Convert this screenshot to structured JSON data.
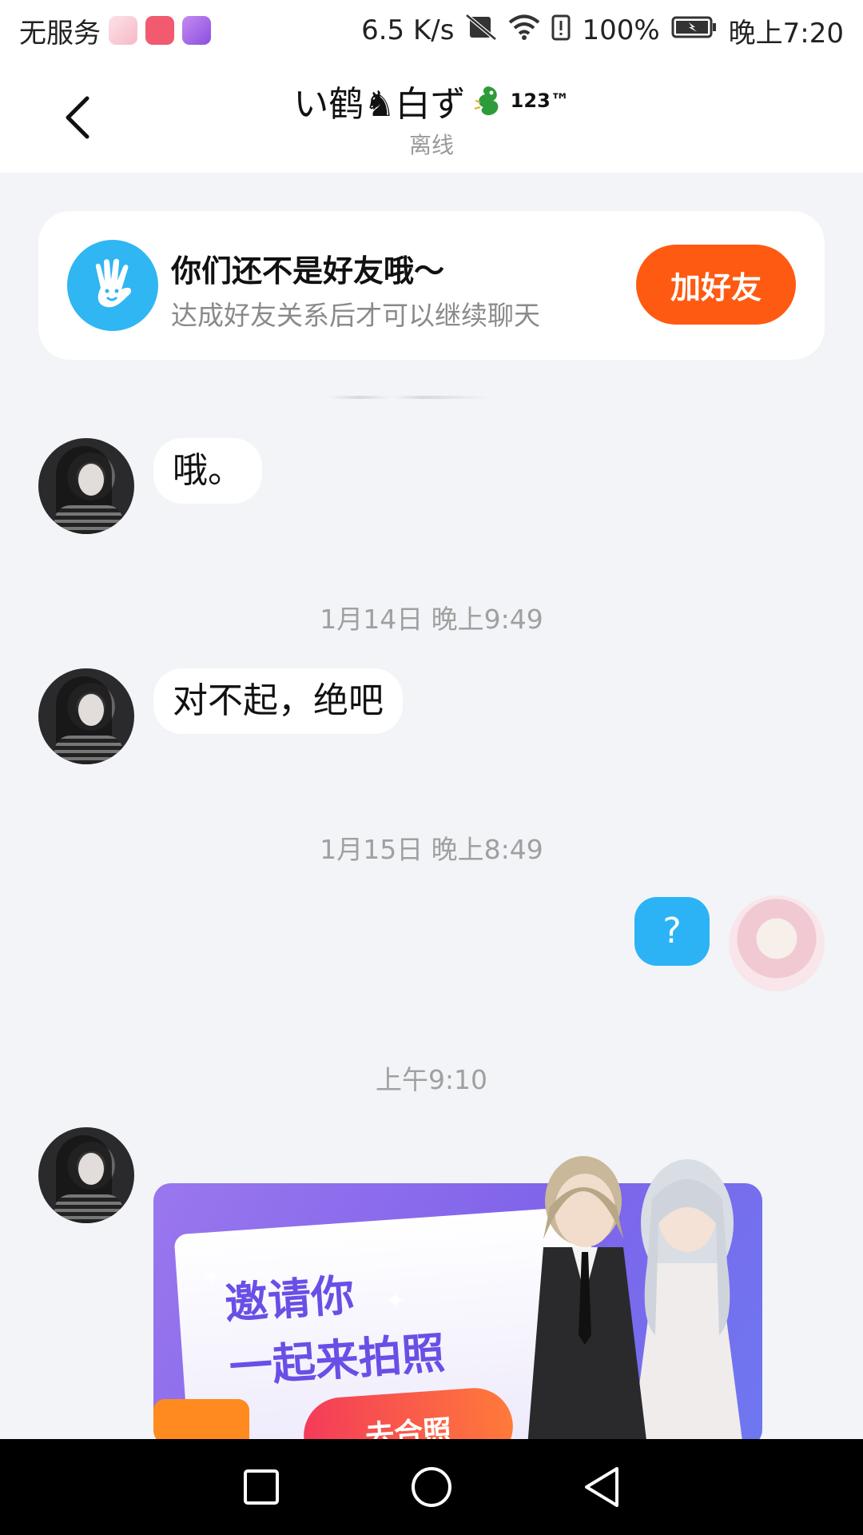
{
  "status_bar": {
    "carrier": "无服务",
    "speed": "6.5 K/s",
    "battery": "100%",
    "time": "晚上7:20",
    "icons": [
      "notification-app-icon",
      "huawei-store-icon",
      "theme-app-icon",
      "no-sim-icon",
      "wifi-icon",
      "battery-alert-icon",
      "battery-charging-icon"
    ]
  },
  "header": {
    "title": "い鹤♞白ず",
    "badge": "123™",
    "status": "离线"
  },
  "friend_banner": {
    "title": "你们还不是好友哦～",
    "subtitle": "达成好友关系后才可以继续聊天",
    "button": "加好友",
    "accent": "#ff5a12"
  },
  "messages": [
    {
      "sender": "other",
      "text": "哦。"
    },
    {
      "timestamp": "1月14日 晚上9:49"
    },
    {
      "sender": "other",
      "text": "对不起，绝吧"
    },
    {
      "timestamp": "1月15日 晚上8:49"
    },
    {
      "sender": "self",
      "text": "?"
    },
    {
      "timestamp": "上午9:10"
    }
  ],
  "invite_card": {
    "title_line1": "邀请你",
    "title_line2": "一起来拍照",
    "button": "去合照"
  },
  "nav_bar": {
    "icons": [
      "recent-apps-icon",
      "home-icon",
      "back-nav-icon"
    ]
  },
  "colors": {
    "self_bubble": "#2bb3f5",
    "background": "#f2f4f7"
  }
}
